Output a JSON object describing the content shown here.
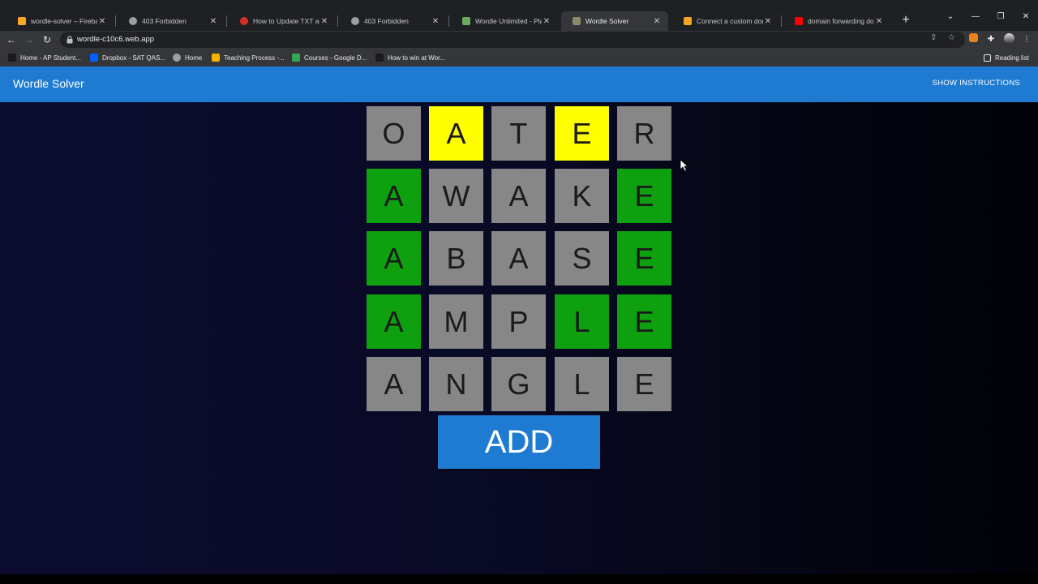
{
  "browser": {
    "tabs": [
      {
        "title": "wordle-solver – Firebase c",
        "favicon": "firebase-icon",
        "color": "#f6a623",
        "active": false
      },
      {
        "title": "403 Forbidden",
        "favicon": "globe-icon",
        "color": "#9aa0a6",
        "active": false
      },
      {
        "title": "How to Update TXT and S",
        "favicon": "red-circle-icon",
        "color": "#d93025",
        "active": false
      },
      {
        "title": "403 Forbidden",
        "favicon": "globe-icon",
        "color": "#9aa0a6",
        "active": false
      },
      {
        "title": "Wordle Unlimited - Play W",
        "favicon": "wordle-unlimited-icon",
        "color": "#6aaa64",
        "active": false
      },
      {
        "title": "Wordle Solver",
        "favicon": "wordle-solver-icon",
        "color": "#8a8a6a",
        "active": true
      },
      {
        "title": "Connect a custom domain",
        "favicon": "firebase-icon",
        "color": "#f6a623",
        "active": false
      },
      {
        "title": "domain forwarding doma",
        "favicon": "youtube-icon",
        "color": "#ff0000",
        "active": false
      }
    ],
    "url": "wordle-c10c6.web.app",
    "bookmarks": [
      {
        "label": "Home - AP Student...",
        "icon": "ap-icon",
        "color": "#1a1a1a"
      },
      {
        "label": "Dropbox - SAT QAS...",
        "icon": "dropbox-icon",
        "color": "#0061fe"
      },
      {
        "label": "Home",
        "icon": "globe-icon",
        "color": "#9aa0a6"
      },
      {
        "label": "Teaching Process -...",
        "icon": "docs-icon",
        "color": "#f4b400"
      },
      {
        "label": "Courses - Google D...",
        "icon": "drive-icon",
        "color": "#34a853"
      },
      {
        "label": "How to win at Wor...",
        "icon": "page-icon",
        "color": "#1a1a1a"
      }
    ],
    "reading_list": "Reading list"
  },
  "app": {
    "title": "Wordle Solver",
    "instructions_label": "SHOW INSTRUCTIONS",
    "add_label": "ADD"
  },
  "board": [
    [
      {
        "letter": "O",
        "state": "gray"
      },
      {
        "letter": "A",
        "state": "yellow"
      },
      {
        "letter": "T",
        "state": "gray"
      },
      {
        "letter": "E",
        "state": "yellow"
      },
      {
        "letter": "R",
        "state": "gray"
      }
    ],
    [
      {
        "letter": "A",
        "state": "green"
      },
      {
        "letter": "W",
        "state": "gray"
      },
      {
        "letter": "A",
        "state": "gray"
      },
      {
        "letter": "K",
        "state": "gray"
      },
      {
        "letter": "E",
        "state": "green"
      }
    ],
    [
      {
        "letter": "A",
        "state": "green"
      },
      {
        "letter": "B",
        "state": "gray"
      },
      {
        "letter": "A",
        "state": "gray"
      },
      {
        "letter": "S",
        "state": "gray"
      },
      {
        "letter": "E",
        "state": "green"
      }
    ],
    [
      {
        "letter": "A",
        "state": "green"
      },
      {
        "letter": "M",
        "state": "gray"
      },
      {
        "letter": "P",
        "state": "gray"
      },
      {
        "letter": "L",
        "state": "green"
      },
      {
        "letter": "E",
        "state": "green"
      }
    ],
    [
      {
        "letter": "A",
        "state": "gray"
      },
      {
        "letter": "N",
        "state": "gray"
      },
      {
        "letter": "G",
        "state": "gray"
      },
      {
        "letter": "L",
        "state": "gray"
      },
      {
        "letter": "E",
        "state": "gray"
      }
    ]
  ],
  "colors": {
    "gray": "#878787",
    "yellow": "#ffff00",
    "green": "#0fa00f",
    "accent": "#1f7bd1"
  }
}
